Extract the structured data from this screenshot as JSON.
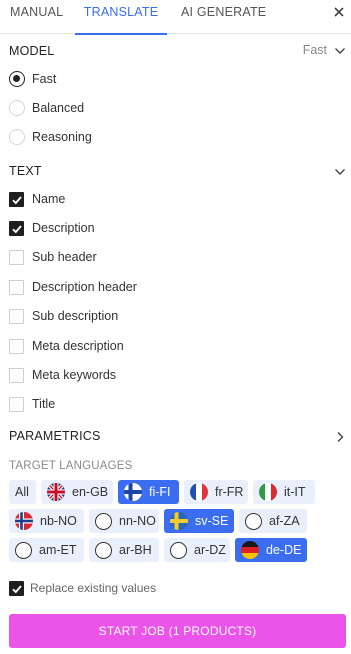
{
  "tabs": [
    "MANUAL",
    "TRANSLATE",
    "AI GENERATE"
  ],
  "model": {
    "label": "MODEL",
    "current": "Fast",
    "options": [
      "Fast",
      "Balanced",
      "Reasoning"
    ],
    "selected": "Fast"
  },
  "text_section": {
    "label": "TEXT",
    "fields": [
      {
        "label": "Name",
        "checked": true
      },
      {
        "label": "Description",
        "checked": true
      },
      {
        "label": "Sub header",
        "checked": false
      },
      {
        "label": "Description header",
        "checked": false
      },
      {
        "label": "Sub description",
        "checked": false
      },
      {
        "label": "Meta description",
        "checked": false
      },
      {
        "label": "Meta keywords",
        "checked": false
      },
      {
        "label": "Title",
        "checked": false
      }
    ]
  },
  "parametrics": {
    "label": "PARAMETRICS"
  },
  "target_languages": {
    "label": "TARGET LANGUAGES",
    "all_label": "All",
    "languages": [
      {
        "code": "en-GB",
        "selected": false
      },
      {
        "code": "fi-FI",
        "selected": true
      },
      {
        "code": "fr-FR",
        "selected": false
      },
      {
        "code": "it-IT",
        "selected": false
      },
      {
        "code": "nb-NO",
        "selected": false
      },
      {
        "code": "nn-NO",
        "selected": false
      },
      {
        "code": "sv-SE",
        "selected": true
      },
      {
        "code": "af-ZA",
        "selected": false
      },
      {
        "code": "am-ET",
        "selected": false
      },
      {
        "code": "ar-BH",
        "selected": false
      },
      {
        "code": "ar-DZ",
        "selected": false
      },
      {
        "code": "de-DE",
        "selected": true
      }
    ]
  },
  "replace_existing": {
    "label": "Replace existing values",
    "checked": true
  },
  "start_button": {
    "label": "START JOB (1 PRODUCTS)"
  },
  "colors": {
    "accent": "#3a6df0",
    "chip_bg": "#e9f0fb",
    "start_button": "#ea54e8"
  }
}
